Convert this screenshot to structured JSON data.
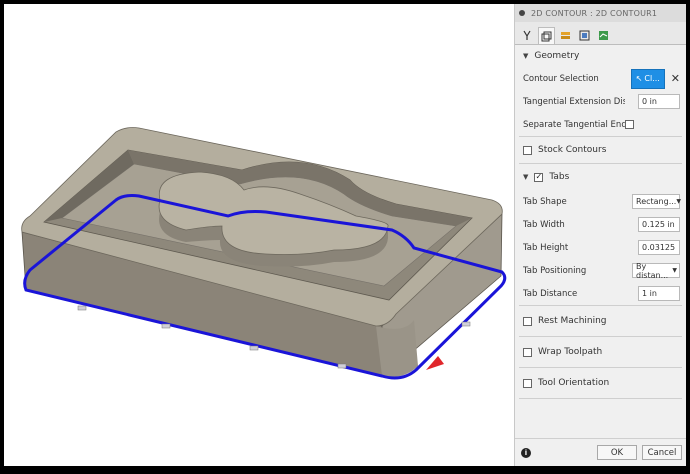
{
  "dialog": {
    "title": "2D CONTOUR : 2D CONTOUR1",
    "tabs": [
      "tool-tab",
      "geometry-tab",
      "heights-tab",
      "passes-tab",
      "linking-tab"
    ],
    "accent_color": "#1f8fe5",
    "toolpath_color": "#1a14d8"
  },
  "geometry": {
    "header": "Geometry",
    "contour_selection_label": "Contour Selection",
    "contour_selection_button": "Cl...",
    "tangential_extension_label": "Tangential Extension Dis...",
    "tangential_extension_value": "0 in",
    "separate_tangential_label": "Separate Tangential End ..."
  },
  "stock_contours": {
    "label": "Stock Contours"
  },
  "tabs_section": {
    "label": "Tabs",
    "tab_shape_label": "Tab Shape",
    "tab_shape_value": "Rectang...",
    "tab_width_label": "Tab Width",
    "tab_width_value": "0.125 in",
    "tab_height_label": "Tab Height",
    "tab_height_value": "0.03125",
    "tab_positioning_label": "Tab Positioning",
    "tab_positioning_value": "By distan...",
    "tab_distance_label": "Tab Distance",
    "tab_distance_value": "1 in"
  },
  "rest_machining": {
    "label": "Rest Machining"
  },
  "wrap_toolpath": {
    "label": "Wrap Toolpath"
  },
  "tool_orientation": {
    "label": "Tool Orientation"
  },
  "footer": {
    "ok": "OK",
    "cancel": "Cancel"
  }
}
